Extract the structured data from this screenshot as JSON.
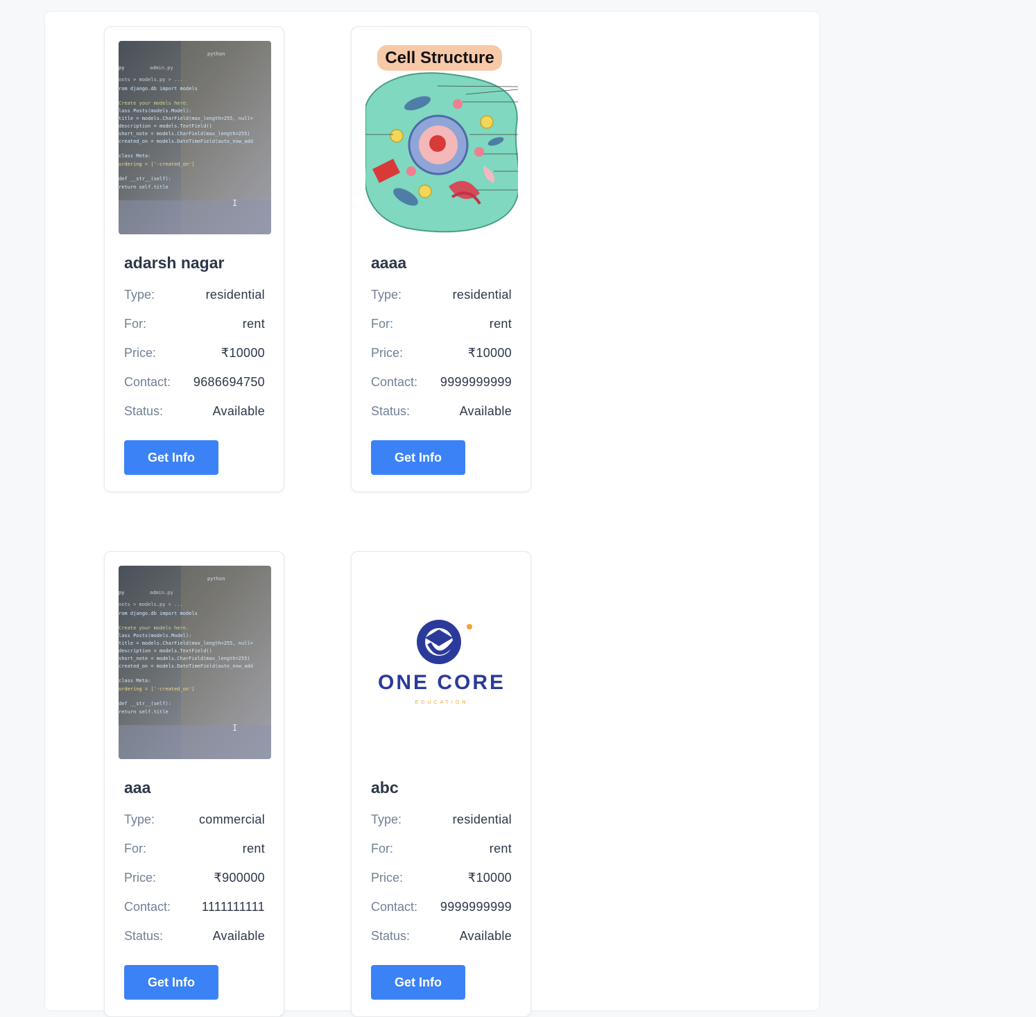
{
  "labels": {
    "type": "Type:",
    "for": "For:",
    "price": "Price:",
    "contact": "Contact:",
    "status": "Status:"
  },
  "listings": [
    {
      "title": "adarsh nagar",
      "image": "code-editor-photo",
      "image_text": {
        "search": "python",
        "tab1": "py",
        "tab2": "admin.py",
        "crumb": "osts > models.py > ...",
        "code": [
          "rom django.db import models",
          "",
          " Create your models here.",
          "lass Posts(models.Model):",
          "   title = models.CharField(max_length=255, null=",
          "   description = models.TextField()",
          "   short_note = models.CharField(max_length=255)",
          "   created_on = models.DateTimeField(auto_now_add",
          "",
          "   class Meta:",
          "       ordering = ['-created_on']",
          "",
          "   def __str__(self):",
          "       return self.title"
        ]
      },
      "type": "residential",
      "for": "rent",
      "price": "₹10000",
      "contact": "9686694750",
      "status": "Available",
      "button": "Get Info"
    },
    {
      "title": "aaaa",
      "image": "cell-structure-diagram",
      "image_text": {
        "heading": "Cell Structure"
      },
      "type": "residential",
      "for": "rent",
      "price": "₹10000",
      "contact": "9999999999",
      "status": "Available",
      "button": "Get Info"
    },
    {
      "title": "aaa",
      "image": "code-editor-photo",
      "type": "commercial",
      "for": "rent",
      "price": "₹900000",
      "contact": "1111111111",
      "status": "Available",
      "button": "Get Info"
    },
    {
      "title": "abc",
      "image": "one-core-logo",
      "image_text": {
        "brand": "ONE CORE",
        "tagline": "EDUCATION"
      },
      "type": "residential",
      "for": "rent",
      "price": "₹10000",
      "contact": "9999999999",
      "status": "Available",
      "button": "Get Info"
    }
  ],
  "colors": {
    "accent": "#3b82f6",
    "page_bg": "#f7f8fa",
    "card_border": "#e6e8ec",
    "label": "#718096",
    "value": "#2d3748"
  }
}
